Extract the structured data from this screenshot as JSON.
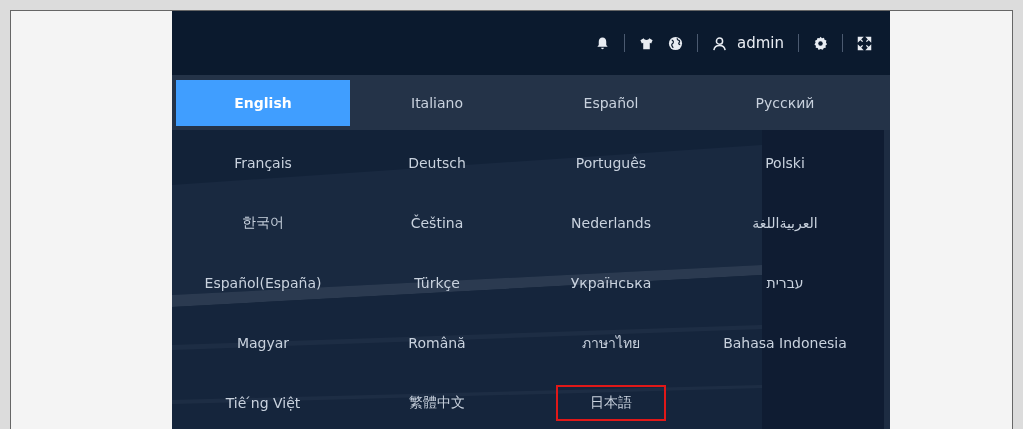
{
  "header": {
    "user": "admin"
  },
  "languages": [
    {
      "label": "English",
      "selected": true,
      "highlighted": false
    },
    {
      "label": "Italiano",
      "selected": false,
      "highlighted": false
    },
    {
      "label": "Español",
      "selected": false,
      "highlighted": false
    },
    {
      "label": "Русский",
      "selected": false,
      "highlighted": false
    },
    {
      "label": "Français",
      "selected": false,
      "highlighted": false
    },
    {
      "label": "Deutsch",
      "selected": false,
      "highlighted": false
    },
    {
      "label": "Português",
      "selected": false,
      "highlighted": false
    },
    {
      "label": "Polski",
      "selected": false,
      "highlighted": false
    },
    {
      "label": "한국어",
      "selected": false,
      "highlighted": false
    },
    {
      "label": "Čeština",
      "selected": false,
      "highlighted": false
    },
    {
      "label": "Nederlands",
      "selected": false,
      "highlighted": false
    },
    {
      "label": "العربيةاللغة",
      "selected": false,
      "highlighted": false
    },
    {
      "label": "Español(España)",
      "selected": false,
      "highlighted": false
    },
    {
      "label": "Türkçe",
      "selected": false,
      "highlighted": false
    },
    {
      "label": "Українська",
      "selected": false,
      "highlighted": false
    },
    {
      "label": "עברית",
      "selected": false,
      "highlighted": false
    },
    {
      "label": "Magyar",
      "selected": false,
      "highlighted": false
    },
    {
      "label": "Română",
      "selected": false,
      "highlighted": false
    },
    {
      "label": "ภาษาไทย",
      "selected": false,
      "highlighted": false
    },
    {
      "label": "Bahasa Indonesia",
      "selected": false,
      "highlighted": false
    },
    {
      "label": "Tiê ́ng Việt",
      "selected": false,
      "highlighted": false
    },
    {
      "label": "繁體中文",
      "selected": false,
      "highlighted": false
    },
    {
      "label": "日本語",
      "selected": false,
      "highlighted": true
    }
  ]
}
